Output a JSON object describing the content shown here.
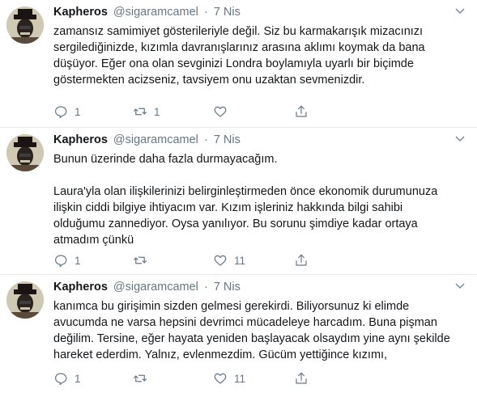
{
  "tweets": [
    {
      "author_name": "Kapheros",
      "handle": "@sigaramcamel",
      "separator": "·",
      "date": "7 Nis",
      "text": "zamansız samimiyet gösterileriyle değil. Siz bu karmakarışık mizacınızı\nsergilediğinizde, kızımla davranışlarınız arasına aklımı koymak da bana\ndüşüyor. Eğer ona olan sevginizi Londra boylamıyla uyarlı bir biçimde\ngöstermekten acizseniz, tavsiyem onu uzaktan sevmenizdir.",
      "reply_count": "1",
      "retweet_count": "1",
      "like_count": ""
    },
    {
      "author_name": "Kapheros",
      "handle": "@sigaramcamel",
      "separator": "·",
      "date": "7 Nis",
      "text": "Bunun üzerinde daha fazla durmayacağım.\n\nLaura'yla olan ilişkilerinizi belirginleştirmeden önce ekonomik durumunuza\nilişkin ciddi bilgiye ihtiyacım var. Kızım işleriniz hakkında bilgi sahibi\nolduğumu zannediyor. Oysa yanılıyor. Bu sorunu şimdiye kadar ortaya\natmadım çünkü",
      "reply_count": "1",
      "retweet_count": "",
      "like_count": "11"
    },
    {
      "author_name": "Kapheros",
      "handle": "@sigaramcamel",
      "separator": "·",
      "date": "7 Nis",
      "text": "kanımca bu girişimin sizden gelmesi gerekirdi. Biliyorsunuz ki elimde\navucumda ne varsa hepsini devrimci mücadeleye harcadım. Buna pişman\ndeğilim. Tersine, eğer hayata yeniden başlayacak olsaydım yine aynı şekilde\nhareket ederdim. Yalnız, evlenmezdim. Gücüm yettiğince kızımı,",
      "reply_count": "1",
      "retweet_count": "",
      "like_count": "11"
    }
  ],
  "icons": {
    "reply": "reply-icon",
    "retweet": "retweet-icon",
    "like": "heart-icon",
    "share": "share-icon",
    "caret": "chevron-down-icon"
  },
  "colors": {
    "text": "#14171a",
    "muted": "#657786",
    "divider": "#e6ecf0"
  }
}
